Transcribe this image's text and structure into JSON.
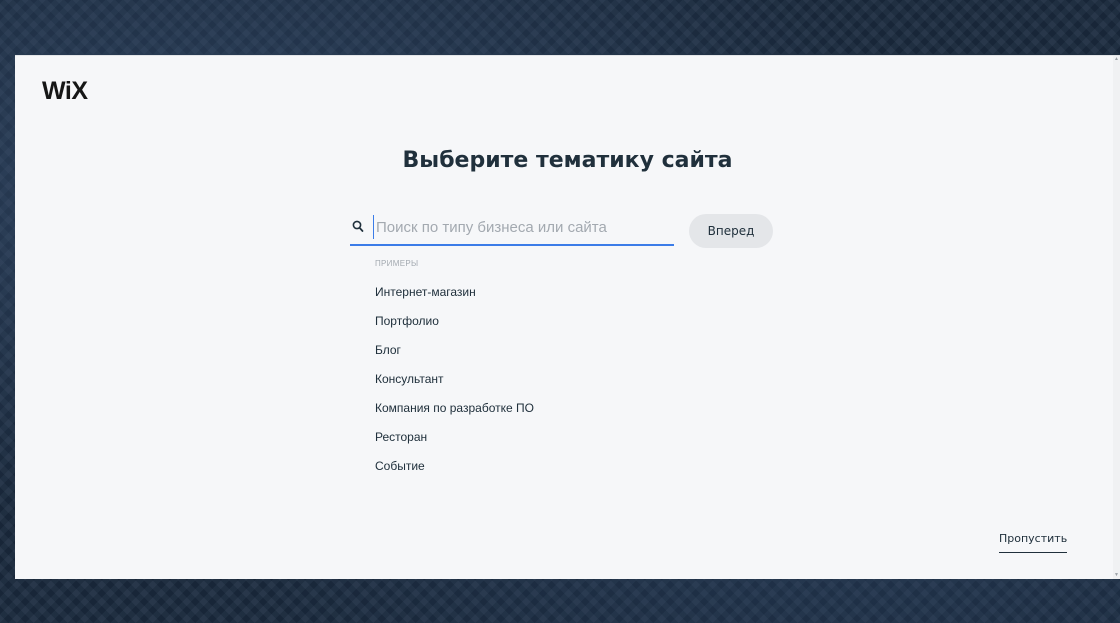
{
  "header": {
    "logo": "WiX"
  },
  "main": {
    "title": "Выберите тематику сайта",
    "search": {
      "placeholder": "Поиск по типу бизнеса или сайта",
      "value": "",
      "icon": "search-icon"
    },
    "go_button_label": "Вперед",
    "examples_label": "ПРИМЕРЫ",
    "examples": [
      "Интернет-магазин",
      "Портфолио",
      "Блог",
      "Консультант",
      "Компания по разработке ПО",
      "Ресторан",
      "Событие"
    ]
  },
  "footer": {
    "skip_label": "Пропустить"
  },
  "colors": {
    "accent": "#3b7ce8",
    "text": "#20303c",
    "placeholder": "#a3a9b0",
    "background": "#f6f7f9",
    "button_bg": "#e4e6e9"
  }
}
